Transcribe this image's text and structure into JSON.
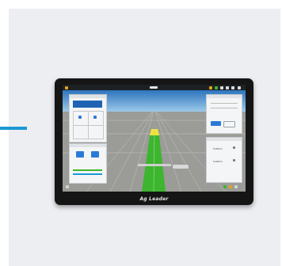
{
  "brand": {
    "name": "Ag Leader"
  },
  "right_panel": {
    "value1": "5,651m",
    "value2": "5,651m"
  },
  "colors": {
    "accent": "#1c99d3",
    "guidance_green": "#3db52f",
    "guidance_yellow": "#f3e23a",
    "panel_blue": "#1f64b4"
  }
}
